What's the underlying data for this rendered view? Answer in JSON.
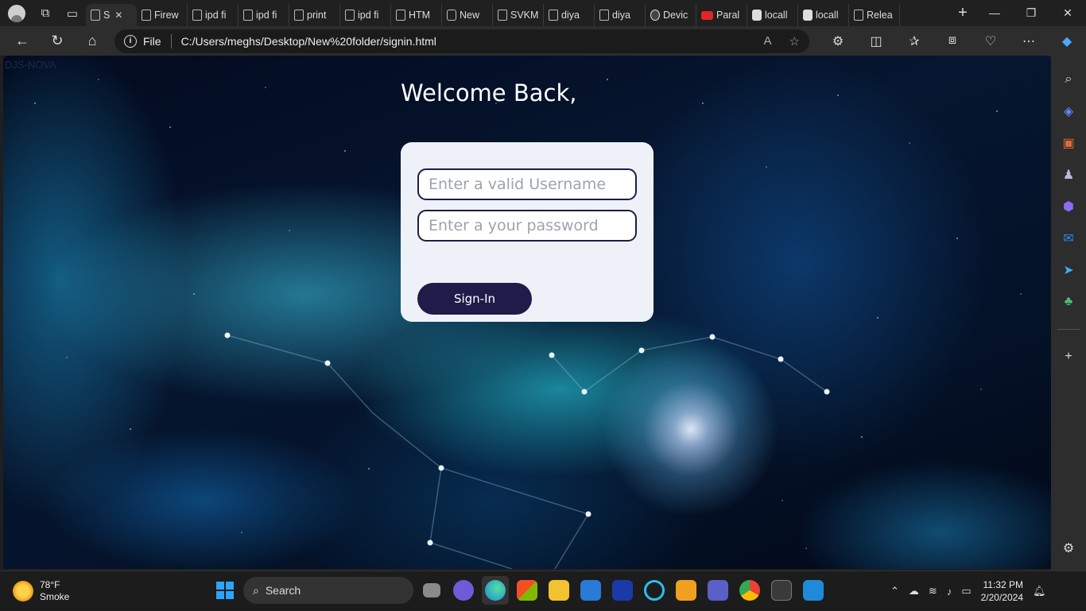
{
  "browser": {
    "tabs": [
      {
        "label": "S",
        "active": true,
        "icon": "page-icon"
      },
      {
        "label": "Firew",
        "icon": "page-icon"
      },
      {
        "label": "ipd fi",
        "icon": "page-icon"
      },
      {
        "label": "ipd fi",
        "icon": "page-icon"
      },
      {
        "label": "print",
        "icon": "page-icon"
      },
      {
        "label": "ipd fi",
        "icon": "page-icon"
      },
      {
        "label": "HTM",
        "icon": "page-icon"
      },
      {
        "label": "New",
        "icon": "sheet-icon"
      },
      {
        "label": "SVKM",
        "icon": "page-icon"
      },
      {
        "label": "diya",
        "icon": "page-icon"
      },
      {
        "label": "diya",
        "icon": "page-icon"
      },
      {
        "label": "Devic",
        "icon": "github-icon"
      },
      {
        "label": "Paral",
        "icon": "youtube-icon"
      },
      {
        "label": "locall",
        "icon": "localhost-icon"
      },
      {
        "label": "locall",
        "icon": "localhost-icon"
      },
      {
        "label": "Relea",
        "icon": "page-icon"
      }
    ],
    "address": {
      "scheme_label": "File",
      "url": "C:/Users/meghs/Desktop/New%20folder/signin.html"
    }
  },
  "page": {
    "brand": "DJS-NOVA",
    "welcome": "Welcome Back,",
    "form": {
      "username_placeholder": "Enter a valid Username",
      "password_placeholder": "Enter a your password",
      "submit_label": "Sign-In"
    }
  },
  "taskbar": {
    "weather_temp": "78°F",
    "weather_desc": "Smoke",
    "search_label": "Search",
    "time": "11:32 PM",
    "date": "2/20/2024"
  },
  "colors": {
    "card_bg": "#eef2f8",
    "button_bg": "#1f1c4a",
    "field_border": "#1f1d45"
  }
}
